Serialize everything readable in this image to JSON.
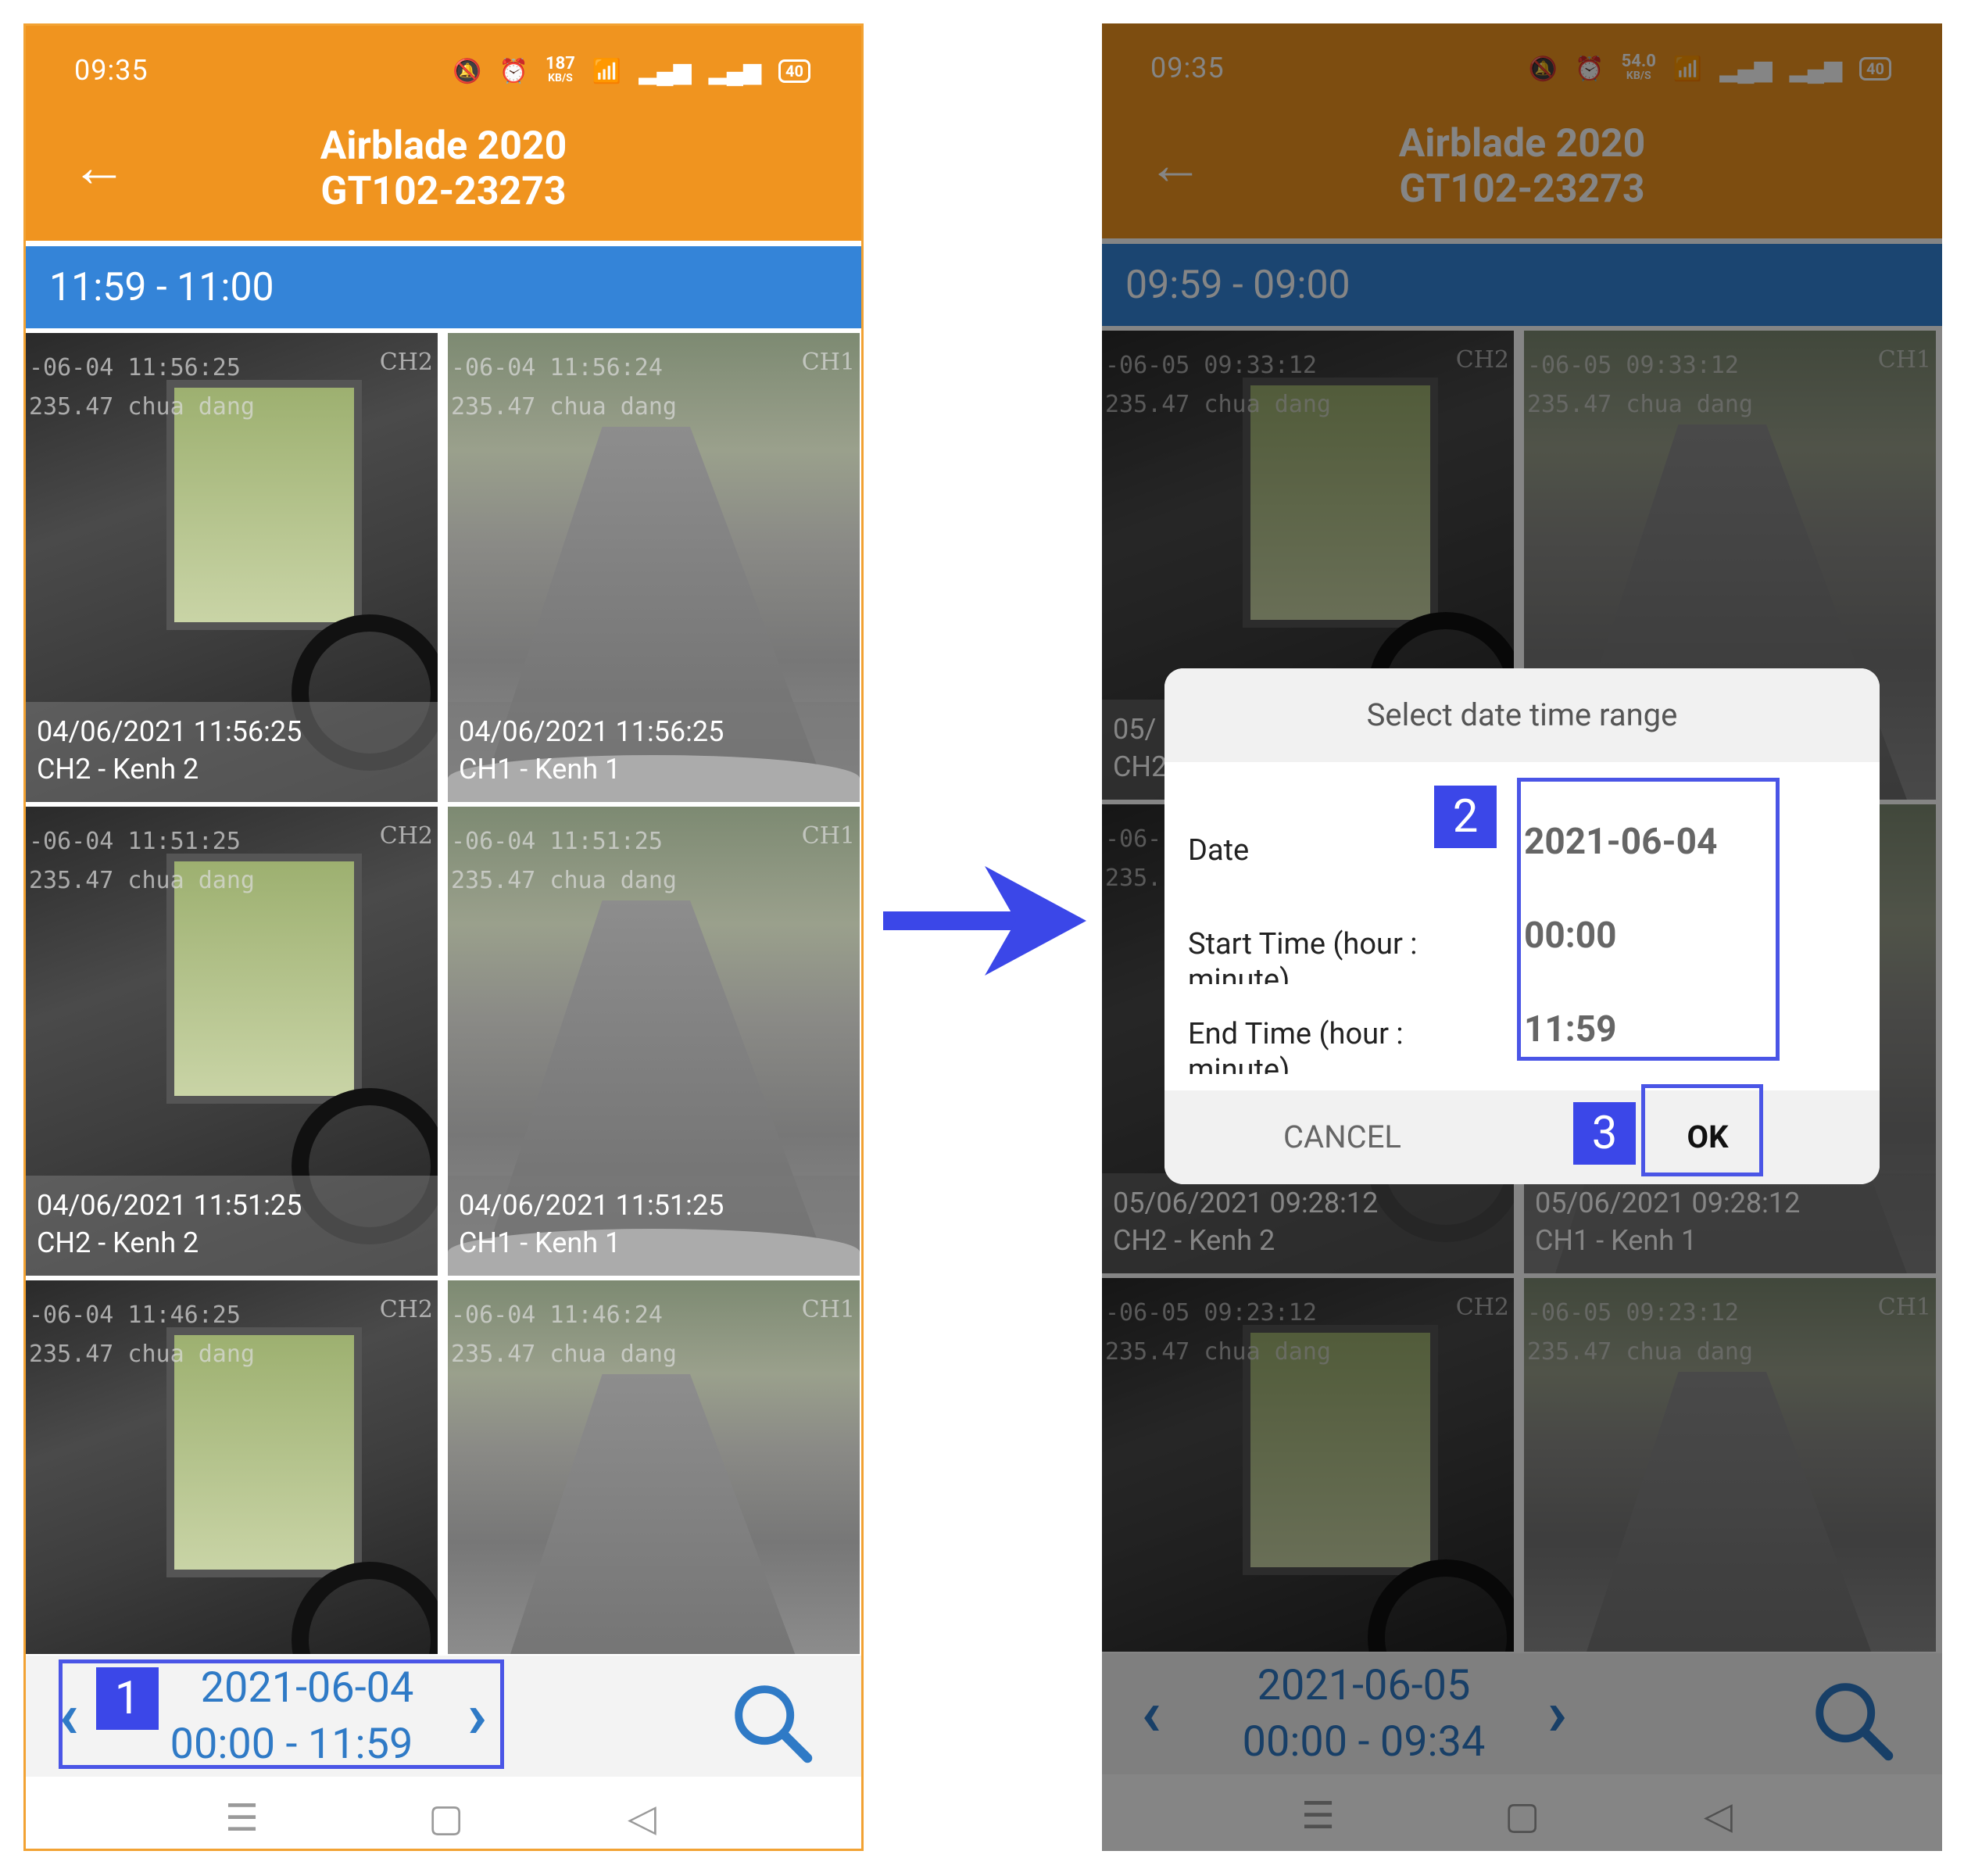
{
  "left_screen": {
    "status_time": "09:35",
    "net_speed_value": "187",
    "net_speed_unit": "KB/S",
    "battery": "40",
    "app_title_line1": "Airblade 2020",
    "app_title_line2": "GT102-23273",
    "hour_range": "11:59 - 11:00",
    "thumbnails": [
      {
        "overlay_line1": "-06-04 11:56:25",
        "overlay_line2": "235.47 chua dang",
        "channel_tag": "CH2",
        "caption_time": "04/06/2021 11:56:25",
        "caption_channel": "CH2 - Kenh 2"
      },
      {
        "overlay_line1": "-06-04 11:56:24",
        "overlay_line2": "235.47 chua dang",
        "channel_tag": "CH1",
        "caption_time": "04/06/2021 11:56:25",
        "caption_channel": "CH1 - Kenh 1"
      },
      {
        "overlay_line1": "-06-04 11:51:25",
        "overlay_line2": "235.47 chua dang",
        "channel_tag": "CH2",
        "caption_time": "04/06/2021 11:51:25",
        "caption_channel": "CH2 - Kenh 2"
      },
      {
        "overlay_line1": "-06-04 11:51:25",
        "overlay_line2": "235.47 chua dang",
        "channel_tag": "CH1",
        "caption_time": "04/06/2021 11:51:25",
        "caption_channel": "CH1 - Kenh 1"
      },
      {
        "overlay_line1": "-06-04 11:46:25",
        "overlay_line2": "235.47 chua dang",
        "channel_tag": "CH2",
        "caption_time": "",
        "caption_channel": ""
      },
      {
        "overlay_line1": "-06-04 11:46:24",
        "overlay_line2": "235.47 chua dang",
        "channel_tag": "CH1",
        "caption_time": "",
        "caption_channel": ""
      }
    ],
    "range_date": "2021-06-04",
    "range_time": "00:00 - 11:59",
    "annotation_1": "1"
  },
  "right_screen": {
    "status_time": "09:35",
    "net_speed_value": "54.0",
    "net_speed_unit": "KB/S",
    "battery": "40",
    "app_title_line1": "Airblade 2020",
    "app_title_line2": "GT102-23273",
    "hour_range": "09:59 - 09:00",
    "thumbnails": [
      {
        "overlay_line1": "-06-05 09:33:12",
        "overlay_line2": "235.47 chua dang",
        "channel_tag": "CH2",
        "caption_time": "05/",
        "caption_channel": "CH2"
      },
      {
        "overlay_line1": "-06-05 09:33:12",
        "overlay_line2": "235.47 chua dang",
        "channel_tag": "CH1",
        "caption_time": "",
        "caption_channel": ""
      },
      {
        "overlay_line1": "-06-",
        "overlay_line2": "235.",
        "channel_tag": "",
        "caption_time": "05/06/2021 09:28:12",
        "caption_channel": "CH2 - Kenh 2"
      },
      {
        "overlay_line1": "",
        "overlay_line2": "",
        "channel_tag": "",
        "caption_time": "05/06/2021 09:28:12",
        "caption_channel": "CH1 - Kenh 1"
      },
      {
        "overlay_line1": "-06-05 09:23:12",
        "overlay_line2": "235.47 chua dang",
        "channel_tag": "CH2",
        "caption_time": "",
        "caption_channel": ""
      },
      {
        "overlay_line1": "-06-05 09:23:12",
        "overlay_line2": "235.47 chua dang",
        "channel_tag": "CH1",
        "caption_time": "",
        "caption_channel": ""
      }
    ],
    "range_date": "2021-06-05",
    "range_time": "00:00 - 09:34",
    "dialog": {
      "title": "Select date time range",
      "date_label": "Date",
      "date_value": "2021-06-04",
      "start_label": "Start Time (hour : minute)",
      "start_value": "00:00",
      "end_label": "End Time (hour : minute)",
      "end_value": "11:59",
      "cancel_label": "CANCEL",
      "ok_label": "OK"
    },
    "annotation_2": "2",
    "annotation_3": "3"
  },
  "colors": {
    "app_orange": "#f0941f",
    "hour_blue": "#3484d8",
    "link_blue": "#2f7ac6",
    "annotation_blue": "#3b47e8"
  },
  "icons": [
    "back-arrow-icon",
    "mute-icon",
    "alarm-icon",
    "wifi-icon",
    "signal-icon",
    "battery-icon",
    "chevron-left-icon",
    "chevron-right-icon",
    "search-icon",
    "menu-icon",
    "home-icon",
    "back-triangle-icon",
    "right-arrow-icon"
  ]
}
